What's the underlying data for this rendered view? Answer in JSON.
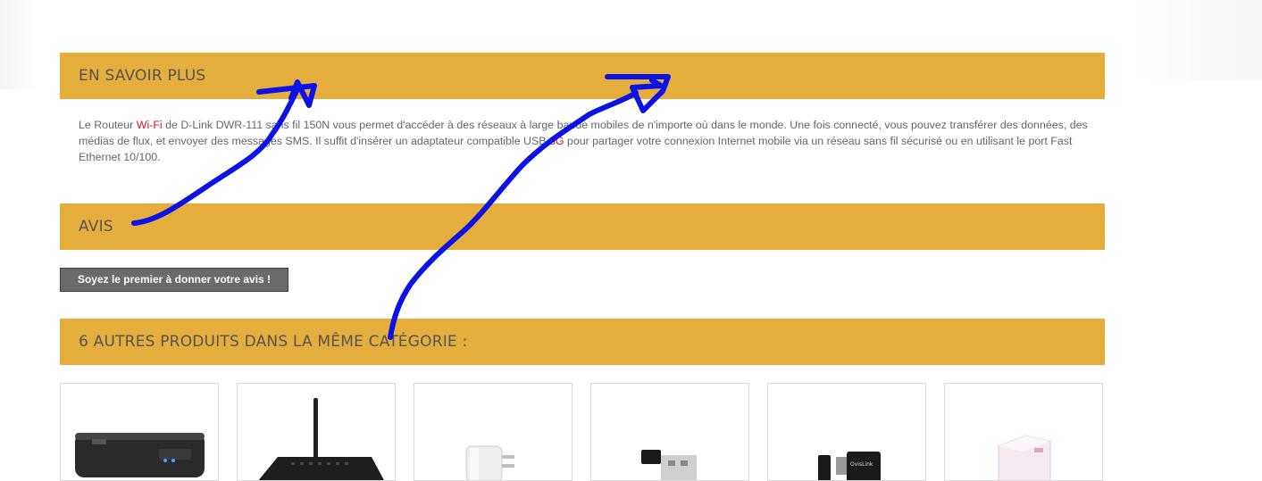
{
  "sections": {
    "more_info_title": "EN SAVOIR PLUS",
    "reviews_title": "AVIS",
    "related_title": "6 AUTRES PRODUITS DANS LA MÊME CATÉGORIE :"
  },
  "description": {
    "p1": "Le Routeur ",
    "link_wifi": "Wi-Fi",
    "p2": " de D-Link DWR-111 sans fil 150N vous permet d'accéder à des réseaux à large bande mobiles de n'importe où dans le monde. Une fois connecté, vous pouvez transférer des données, des médias de flux, et envoyer des messages SMS. Il suffit d'insérer un adaptateur compatible USB ",
    "link_3g": "3G",
    "p3": " pour partager votre connexion Internet mobile via un réseau sans fil sécurisé ou en utilisant le port Fast Ethernet 10/100."
  },
  "reviews": {
    "first_review_button": "Soyez le premier à donner votre avis !"
  },
  "products": [
    {
      "icon": "portable-router-icon"
    },
    {
      "icon": "antenna-router-icon"
    },
    {
      "icon": "plug-adapter-icon"
    },
    {
      "icon": "usb-dongle-icon"
    },
    {
      "icon": "usb-stick-icon"
    },
    {
      "icon": "powerline-adapter-icon"
    }
  ],
  "colors": {
    "section_bar": "#e5ad3c",
    "link_red": "#cc1a1a",
    "button_bg": "#6b6b6b",
    "annotation_blue": "#0a12e6"
  }
}
